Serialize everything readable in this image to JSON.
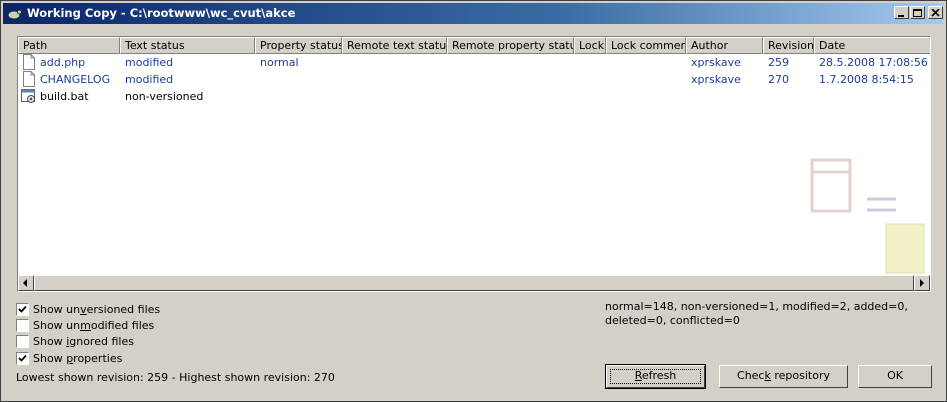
{
  "window": {
    "title": "Working Copy - C:\\rootwww\\wc_cvut\\akce"
  },
  "titlebar_buttons": [
    "minimize-button",
    "maximize-button",
    "close-button"
  ],
  "columns": [
    "Path",
    "Text status",
    "Property status",
    "Remote text status",
    "Remote property status",
    "Lock",
    "Lock comment",
    "Author",
    "Revision",
    "Date"
  ],
  "rows": [
    {
      "path": "add.php",
      "icon": "file-icon",
      "text_status": "modified",
      "property_status": "normal",
      "author": "xprskave",
      "revision": "259",
      "date": "28.5.2008 17:08:56"
    },
    {
      "path": "CHANGELOG",
      "icon": "file-icon",
      "text_status": "modified",
      "property_status": "",
      "author": "xprskave",
      "revision": "270",
      "date": "1.7.2008 8:54:15"
    },
    {
      "path": "build.bat",
      "icon": "batch-file-icon",
      "text_status": "non-versioned",
      "property_status": "",
      "author": "",
      "revision": "",
      "date": ""
    }
  ],
  "options": {
    "show_unversioned": {
      "pre": "Show un",
      "u": "v",
      "post": "ersioned files",
      "checked": true
    },
    "show_unmodified": {
      "pre": "Show un",
      "u": "m",
      "post": "odified files",
      "checked": false
    },
    "show_ignored": {
      "pre": "Show ",
      "u": "i",
      "post": "gnored files",
      "checked": false
    },
    "show_properties": {
      "pre": "Show ",
      "u": "p",
      "post": "roperties",
      "checked": true
    }
  },
  "summary": "normal=148, non-versioned=1, modified=2, added=0, deleted=0, conflicted=0",
  "revision_info": "Lowest shown revision: 259 - Highest shown revision: 270",
  "buttons": {
    "refresh": {
      "u": "R",
      "rest": "efresh"
    },
    "check_repository": {
      "pre": "Chec",
      "u": "k",
      "post": " repository"
    },
    "ok": "OK"
  },
  "colors": {
    "link_blue": "#1e3c96",
    "title_start": "#0a246a",
    "title_end": "#a6caf0"
  }
}
